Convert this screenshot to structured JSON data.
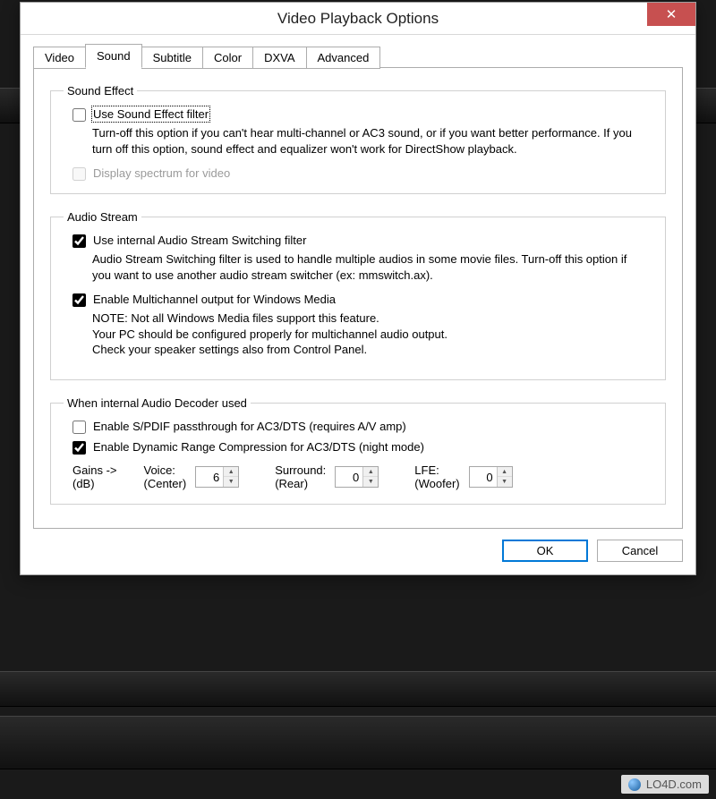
{
  "window": {
    "title": "Video Playback Options",
    "close_glyph": "✕"
  },
  "tabs": [
    "Video",
    "Sound",
    "Subtitle",
    "Color",
    "DXVA",
    "Advanced"
  ],
  "active_tab": "Sound",
  "group_sound_effect": {
    "legend": "Sound Effect",
    "use_filter_label": "Use Sound Effect filter",
    "use_filter_checked": false,
    "use_filter_desc": "Turn-off this option if you can't hear multi-channel or AC3 sound, or if you want better performance.  If you turn off this option, sound effect and equalizer won't work for DirectShow playback.",
    "display_spectrum_label": "Display spectrum for video",
    "display_spectrum_checked": false,
    "display_spectrum_enabled": false
  },
  "group_audio_stream": {
    "legend": "Audio Stream",
    "use_switch_label": "Use internal Audio Stream Switching filter",
    "use_switch_checked": true,
    "use_switch_desc": "Audio Stream Switching filter is used to handle multiple audios in some movie files. Turn-off this option if you want to use another audio stream switcher (ex: mmswitch.ax).",
    "multichannel_label": "Enable Multichannel output for Windows Media",
    "multichannel_checked": true,
    "multichannel_desc": "NOTE: Not all Windows Media files support this feature.\nYour PC should be configured properly for multichannel audio output.\nCheck your speaker settings also from Control Panel."
  },
  "group_decoder": {
    "legend": "When internal Audio Decoder used",
    "spdif_label": "Enable S/PDIF passthrough for AC3/DTS (requires A/V amp)",
    "spdif_checked": false,
    "drc_label": "Enable Dynamic Range Compression for AC3/DTS (night mode)",
    "drc_checked": true,
    "gains_label_1": "Gains ->",
    "gains_label_2": "(dB)",
    "voice_label_1": "Voice:",
    "voice_label_2": "(Center)",
    "voice_value": "6",
    "surround_label_1": "Surround:",
    "surround_label_2": "(Rear)",
    "surround_value": "0",
    "lfe_label_1": "LFE:",
    "lfe_label_2": "(Woofer)",
    "lfe_value": "0"
  },
  "buttons": {
    "ok": "OK",
    "cancel": "Cancel"
  },
  "watermark": "LO4D.com"
}
